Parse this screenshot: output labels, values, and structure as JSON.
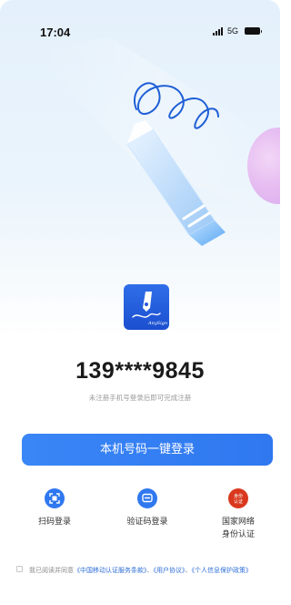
{
  "status_bar": {
    "time": "17:04",
    "network": "5G"
  },
  "login": {
    "masked_phone": "139****9845",
    "hint": "未注册手机号登录后即可完成注册",
    "one_tap_button": "本机号码一键登录"
  },
  "logo": {
    "text": "AnySign"
  },
  "alternatives": [
    {
      "label": "扫码登录",
      "icon": "scan-icon"
    },
    {
      "label": "验证码登录",
      "icon": "message-icon"
    },
    {
      "label_line1": "国家网络",
      "label_line2": "身份认证",
      "icon_text_line1": "身份",
      "icon_text_line2": "认证",
      "icon": "national-id-icon"
    }
  ],
  "agreement": {
    "prefix": "我已阅读并同意",
    "link1": "《中国移动认证服务条款》",
    "sep1": "、",
    "link2": "《用户协议》",
    "sep2": "、",
    "link3": "《个人信息保护政策》"
  },
  "colors": {
    "primary": "#2f78f0",
    "link": "#2f6fd8",
    "national_id": "#d9381e"
  }
}
